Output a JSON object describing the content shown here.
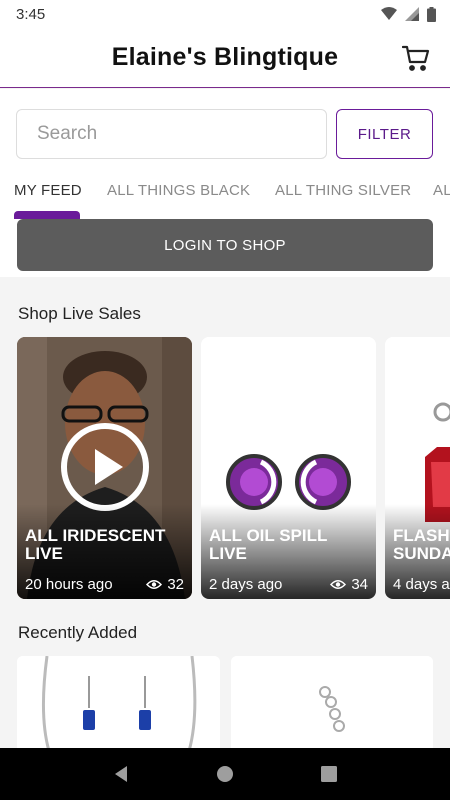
{
  "status_bar": {
    "time": "3:45"
  },
  "header": {
    "title": "Elaine's Blingtique",
    "cart_icon": "cart-icon"
  },
  "search": {
    "placeholder": "Search",
    "filter_label": "FILTER"
  },
  "tabs": [
    {
      "label": "MY FEED",
      "active": true
    },
    {
      "label": "ALL THINGS BLACK",
      "active": false
    },
    {
      "label": "ALL THING SILVER",
      "active": false
    },
    {
      "label": "AL",
      "active": false
    }
  ],
  "login": {
    "label": "LOGIN TO SHOP"
  },
  "live_sales": {
    "heading": "Shop Live Sales",
    "cards": [
      {
        "title": "ALL IRIDESCENT LIVE",
        "time": "20 hours ago",
        "views": "32",
        "has_play": true
      },
      {
        "title": "ALL OIL SPILL LIVE",
        "time": "2 days ago",
        "views": "34",
        "has_play": false
      },
      {
        "title": "FLASH SUNDA",
        "time": "4 days a",
        "views": "",
        "has_play": false
      }
    ]
  },
  "recently_added": {
    "heading": "Recently Added"
  },
  "colors": {
    "accent": "#6a1b9a",
    "login_bg": "#5c5c5c"
  }
}
